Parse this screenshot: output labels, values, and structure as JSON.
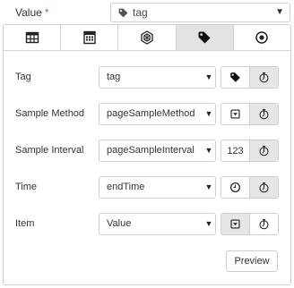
{
  "value_field": {
    "label": "Value",
    "required_marker": "*",
    "selected": "tag",
    "icon": "tag-icon"
  },
  "tabs": [
    {
      "name": "table-icon",
      "active": false
    },
    {
      "name": "calculator-icon",
      "active": false
    },
    {
      "name": "hexagon-icon",
      "active": false
    },
    {
      "name": "tag-icon",
      "active": true
    },
    {
      "name": "radio-button-icon",
      "active": false
    }
  ],
  "rows": [
    {
      "label": "Tag",
      "value": "tag",
      "buttons": [
        "tag-icon",
        "expression-icon"
      ],
      "active_button": 1
    },
    {
      "label": "Sample Method",
      "value": "pageSampleMethod",
      "buttons": [
        "dropdown-icon",
        "expression-icon"
      ],
      "active_button": 1
    },
    {
      "label": "Sample Interval",
      "value": "pageSampleInterval",
      "buttons": [
        "number-icon",
        "expression-icon"
      ],
      "number_text": "123",
      "active_button": 1
    },
    {
      "label": "Time",
      "value": "endTime",
      "buttons": [
        "clock-icon",
        "expression-icon"
      ],
      "active_button": 1
    },
    {
      "label": "Item",
      "value": "Value",
      "buttons": [
        "dropdown-icon",
        "expression-icon"
      ],
      "active_button": 0
    }
  ],
  "preview_label": "Preview",
  "colors": {
    "required": "#d9534f",
    "active_background": "#e3e3e3",
    "border": "#cfcfcf"
  }
}
